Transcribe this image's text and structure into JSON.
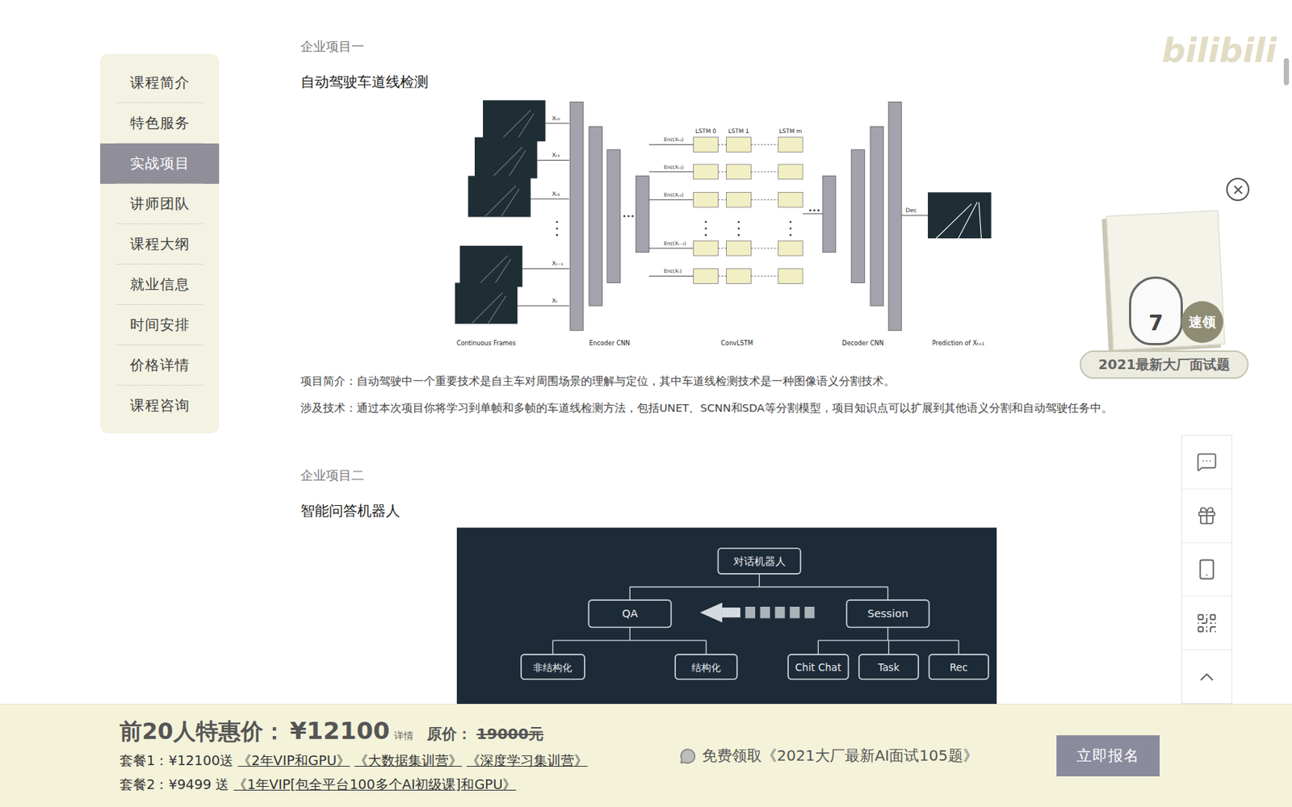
{
  "watermark": "bilibili",
  "sidebar": {
    "items": [
      {
        "label": "课程简介",
        "selected": false
      },
      {
        "label": "特色服务",
        "selected": false
      },
      {
        "label": "实战项目",
        "selected": true
      },
      {
        "label": "讲师团队",
        "selected": false
      },
      {
        "label": "课程大纲",
        "selected": false
      },
      {
        "label": "就业信息",
        "selected": false
      },
      {
        "label": "时间安排",
        "selected": false
      },
      {
        "label": "价格详情",
        "selected": false
      },
      {
        "label": "课程咨询",
        "selected": false
      }
    ]
  },
  "projects": [
    {
      "kind": "lane",
      "heading": "企业项目一",
      "title": "自动驾驶车道线检测",
      "figure": {
        "frame_labels": [
          "Xₜ₀",
          "Xₜ₁",
          "Xₜ₂",
          "Xₜ₋₁",
          "Xₜ"
        ],
        "enc_labels": [
          "Enc(Xₜ₀)",
          "Enc(Xₜ₁)",
          "Enc(Xₜ₂)",
          "Enc(Xₜ₋₁)",
          "Enc(Xₜ)"
        ],
        "lstm_headers": [
          "LSTM 0",
          "LSTM 1",
          "LSTM m"
        ],
        "dec_label": "Dec",
        "captions": [
          "Continuous Frames",
          "Encoder CNN",
          "ConvLSTM",
          "Decoder CNN",
          "Prediction of Xₜ₊₁"
        ]
      },
      "paragraphs": [
        "项目简介：自动驾驶中一个重要技术是自主车对周围场景的理解与定位，其中车道线检测技术是一种图像语义分割技术。",
        "涉及技术：通过本次项目你将学习到单帧和多帧的车道线检测方法，包括UNET、SCNN和SDA等分割模型，项目知识点可以扩展到其他语义分割和自动驾驶任务中。"
      ]
    },
    {
      "kind": "bot",
      "heading": "企业项目二",
      "title": "智能问答机器人",
      "figure": {
        "root": "对话机器人",
        "branches": [
          {
            "label": "QA",
            "children": [
              "非结构化",
              "结构化"
            ]
          },
          {
            "label": "Session",
            "children": [
              "Chit Chat",
              "Task",
              "Rec"
            ]
          }
        ]
      },
      "paragraphs": []
    }
  ],
  "promo": {
    "number": "7",
    "action": "速领",
    "badge": "2021最新大厂面试题"
  },
  "price_bar": {
    "label": "前20人特惠价：",
    "price": "¥12100",
    "detail": "详情",
    "original_label": "原价：",
    "original_price": "19000元",
    "packages": [
      {
        "label": "套餐1：",
        "price": "¥12100送",
        "gifts": [
          "《2年VIP和GPU》",
          "《大数据集训营》",
          "《深度学习集训营》"
        ]
      },
      {
        "label": "套餐2：",
        "price": "¥9499 送",
        "gifts": [
          "《1年VIP[包全平台100多个AI初级课]和GPU》"
        ]
      }
    ],
    "free_offer": "免费领取《2021大厂最新AI面试105题》",
    "button": "立即报名"
  }
}
